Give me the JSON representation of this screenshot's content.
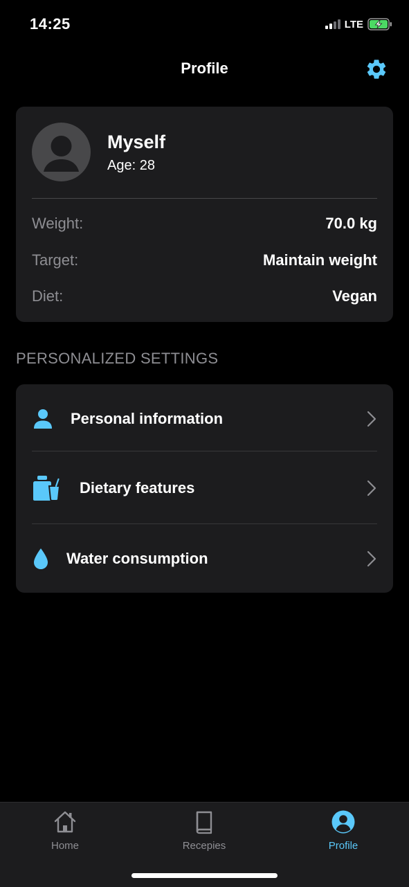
{
  "status_bar": {
    "time": "14:25",
    "network": "LTE"
  },
  "nav": {
    "title": "Profile",
    "settings_icon": "gear-icon"
  },
  "profile": {
    "name": "Myself",
    "age": "Age: 28",
    "rows": [
      {
        "label": "Weight:",
        "value": "70.0 kg"
      },
      {
        "label": "Target:",
        "value": "Maintain weight"
      },
      {
        "label": "Diet:",
        "value": "Vegan"
      }
    ]
  },
  "settings": {
    "section_title": "PERSONALIZED SETTINGS",
    "items": [
      {
        "label": "Personal information",
        "icon": "person-icon"
      },
      {
        "label": "Dietary features",
        "icon": "food-drink-icon"
      },
      {
        "label": "Water consumption",
        "icon": "water-drop-icon"
      }
    ]
  },
  "tabs": [
    {
      "label": "Home",
      "icon": "home-icon",
      "active": false
    },
    {
      "label": "Recepies",
      "icon": "book-icon",
      "active": false
    },
    {
      "label": "Profile",
      "icon": "profile-icon",
      "active": true
    }
  ],
  "colors": {
    "accent": "#5ac8fa",
    "background": "#000000",
    "card": "#1c1c1e",
    "secondary_text": "#8e8e93",
    "inactive_tab": "#8e8e93",
    "battery_green": "#4cd964"
  }
}
